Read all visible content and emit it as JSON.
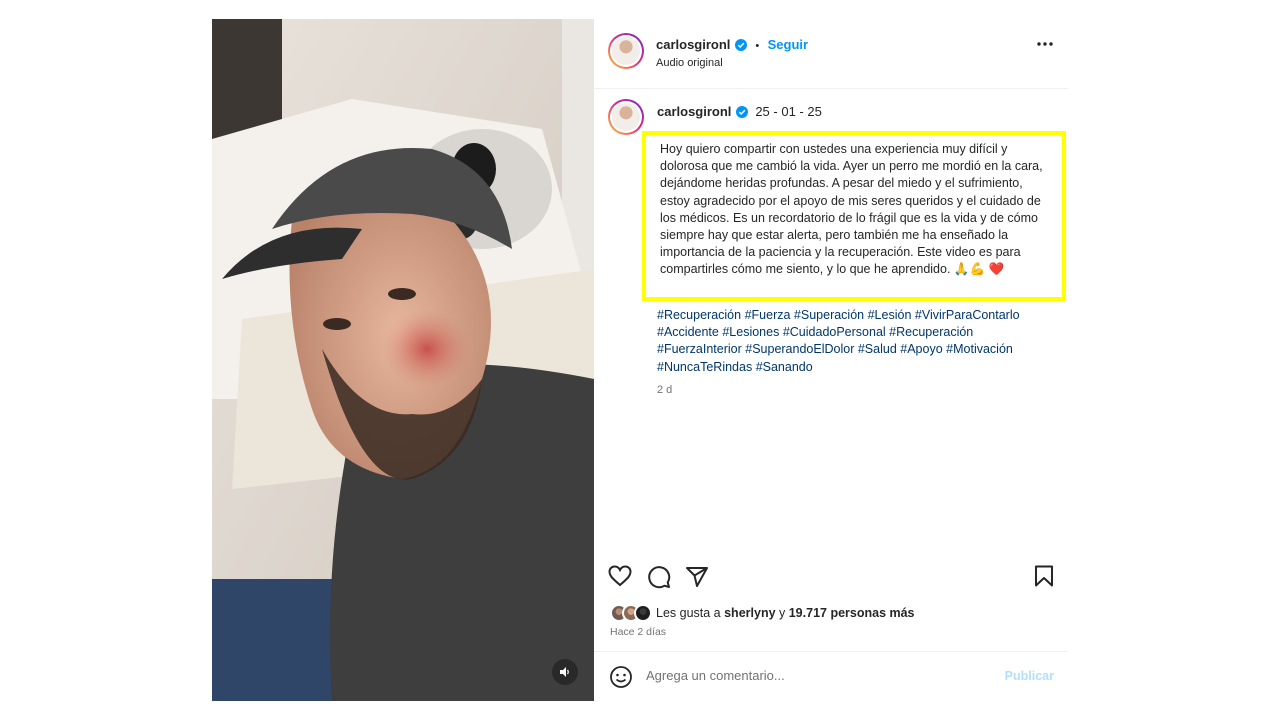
{
  "post": {
    "author": "carlosgironl",
    "header": {
      "follow_label": "Seguir",
      "separator": "•",
      "audio_label": "Audio original",
      "more_icon": "more-icon"
    },
    "caption": {
      "date": "25 - 01 - 25",
      "text": "Hoy quiero compartir con ustedes una experiencia muy difícil y dolorosa que me cambió la vida. Ayer un perro me mordió en la cara, dejándome heridas profundas. A pesar del miedo y el sufrimiento, estoy agradecido por el apoyo de mis seres queridos y el cuidado de los médicos. Es un recordatorio de lo frágil que es la vida y de cómo siempre hay que estar alerta, pero también me ha enseñado la importancia de la paciencia y la recuperación. Este video es para compartirles cómo me siento, y lo que he aprendido. 🙏💪 ❤️",
      "hashtags": [
        "#Recuperación",
        "#Fuerza",
        "#Superación",
        "#Lesión",
        "#VivirParaContarlo",
        "#Accidente",
        "#Lesiones",
        "#CuidadoPersonal",
        "#Recuperación",
        "#FuerzaInterior",
        "#SuperandoElDolor",
        "#Salud",
        "#Apoyo",
        "#Motivación",
        "#NuncaTeRindas",
        "#Sanando"
      ],
      "time_ago": "2 d"
    },
    "likes": {
      "prefix": "Les gusta a ",
      "user": "sherlyny",
      "joiner": " y ",
      "count_text": "19.717 personas más"
    },
    "posted_ago": "Hace 2 días",
    "comment": {
      "placeholder": "Agrega un comentario...",
      "publish_label": "Publicar"
    }
  },
  "colors": {
    "accent": "#0095f6",
    "hashtag": "#00376b",
    "highlight": "#ffff00",
    "muted": "#737373"
  }
}
